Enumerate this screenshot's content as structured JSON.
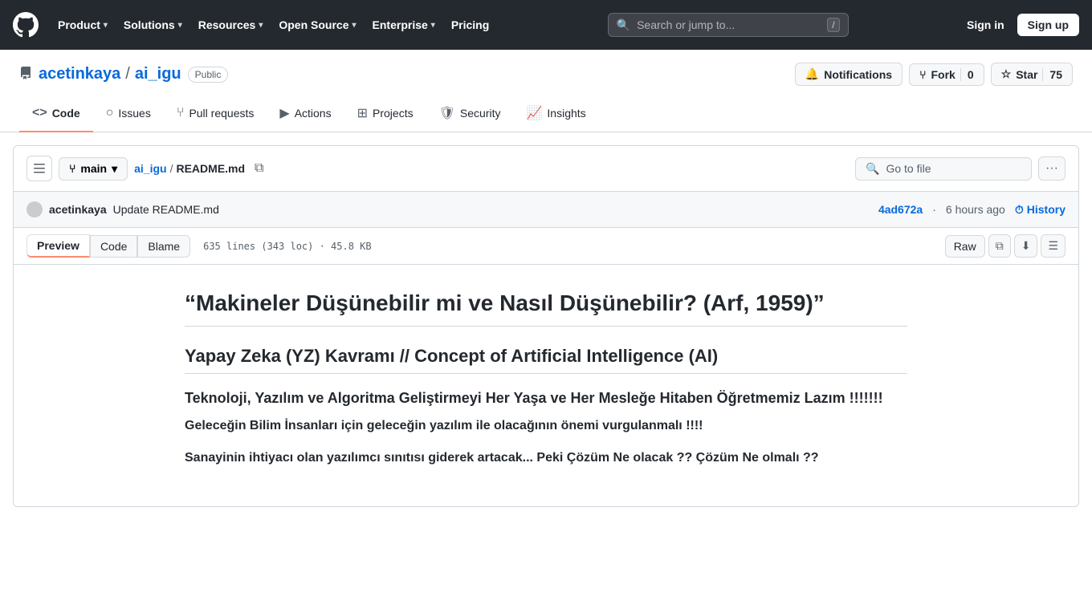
{
  "nav": {
    "logo_label": "GitHub",
    "items": [
      {
        "label": "Product",
        "id": "product"
      },
      {
        "label": "Solutions",
        "id": "solutions"
      },
      {
        "label": "Resources",
        "id": "resources"
      },
      {
        "label": "Open Source",
        "id": "open-source"
      },
      {
        "label": "Enterprise",
        "id": "enterprise"
      },
      {
        "label": "Pricing",
        "id": "pricing"
      }
    ],
    "search_placeholder": "Search or jump to...",
    "search_shortcut": "/",
    "signin_label": "Sign in",
    "signup_label": "Sign up"
  },
  "repo": {
    "owner": "acetinkaya",
    "name": "ai_igu",
    "visibility": "Public",
    "notifications_label": "Notifications",
    "fork_label": "Fork",
    "fork_count": "0",
    "star_label": "Star",
    "star_count": "75"
  },
  "tabs": [
    {
      "label": "Code",
      "icon": "code",
      "active": true
    },
    {
      "label": "Issues",
      "icon": "issue"
    },
    {
      "label": "Pull requests",
      "icon": "pr"
    },
    {
      "label": "Actions",
      "icon": "action"
    },
    {
      "label": "Projects",
      "icon": "project"
    },
    {
      "label": "Security",
      "icon": "security"
    },
    {
      "label": "Insights",
      "icon": "insights"
    }
  ],
  "file": {
    "branch": "main",
    "path_repo": "ai_igu",
    "path_file": "README.md",
    "go_to_file_placeholder": "Go to file",
    "copy_label": "Copy path",
    "more_options_label": "More options"
  },
  "commit": {
    "author": "acetinkaya",
    "avatar_label": "acetinkaya avatar",
    "message": "Update README.md",
    "sha": "4ad672a",
    "time": "6 hours ago",
    "history_label": "History"
  },
  "toolbar": {
    "preview_label": "Preview",
    "code_label": "Code",
    "blame_label": "Blame",
    "file_stats": "635 lines (343 loc) · 45.8 KB",
    "raw_label": "Raw",
    "copy_icon_label": "Copy raw file",
    "download_label": "Download raw file",
    "outline_label": "Outline"
  },
  "readme": {
    "h1": "“Makineler Düşünebilir mi ve Nasıl Düşünebilir? (Arf, 1959)”",
    "h2": "Yapay Zeka (YZ) Kavramı // Concept of Artificial Intelligence (AI)",
    "h3": "Teknoloji, Yazılım ve Algoritma Geliştirmeyi Her Yaşa ve Her Mesleğe Hitaben Öğretmemiz Lazım !!!!!!!",
    "p1": "Geleceğin Bilim İnsanları için geleceğin yazılım ile olacağının önemi vurgulanmalı !!!!",
    "p2": "Sanayinin ihtiyacı olan yazılımcı sınıtısı giderek artacak... Peki Çözüm Ne olacak ?? Çözüm Ne olmalı ??"
  }
}
